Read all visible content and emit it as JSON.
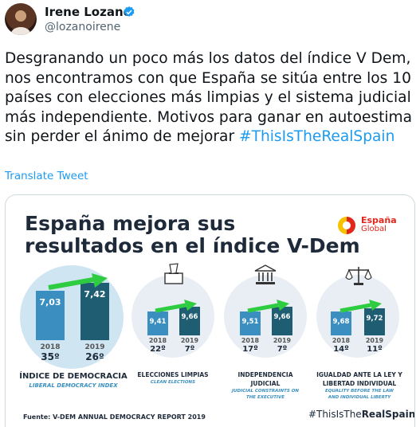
{
  "author": {
    "display_name": "Irene Lozano",
    "handle": "@lozanoirene",
    "verified_icon": "verified-badge-icon"
  },
  "tweet": {
    "text": "Desgranando un poco más los datos del índice V Dem, nos encontramos con que España se sitúa entre los 10 países con elecciones más limpias y el sistema judicial más independiente. Motivos para ganar en autoestima sin perder el ánimo de mejorar ",
    "hashtag": "#ThisIsTheRealSpain",
    "translate_label": "Translate Tweet"
  },
  "colors": {
    "link": "#1d9bf0",
    "bar_2018": "#3a8fc0",
    "bar_2019": "#1f5d73",
    "arrow": "#2ecc40",
    "brand_red": "#e1261c"
  },
  "infographic": {
    "title_line1": "España mejora sus",
    "title_line2": "resultados en el índice V-Dem",
    "brand_name": "España",
    "brand_sub": "Global",
    "source": "Fuente: V-DEM ANNUAL DEMOCRACY REPORT 2019",
    "hashtag_prefix": "#ThisIsThe",
    "hashtag_bold": "RealSpain",
    "panels": [
      {
        "caption": "ÍNDICE DE DEMOCRACIA",
        "subcaption": "LIBERAL DEMOCRACY INDEX",
        "icon": "none",
        "value_2018": "7,03",
        "value_2019": "7,42",
        "year_2018": "2018",
        "year_2019": "2019",
        "rank_2018": "35º",
        "rank_2019": "26º"
      },
      {
        "caption": "ELECCIONES LIMPIAS",
        "subcaption": "CLEAN ELECTIONS",
        "icon": "ballot-box-icon",
        "value_2018": "9,41",
        "value_2019": "9,66",
        "year_2018": "2018",
        "year_2019": "2019",
        "rank_2018": "22º",
        "rank_2019": "7º"
      },
      {
        "caption": "INDEPENDENCIA JUDICIAL",
        "subcaption": "JUDICIAL CONSTRAINTS ON THE EXECUTIVE",
        "icon": "courthouse-icon",
        "value_2018": "9,51",
        "value_2019": "9,66",
        "year_2018": "2018",
        "year_2019": "2019",
        "rank_2018": "17º",
        "rank_2019": "7º"
      },
      {
        "caption": "IGUALDAD ANTE LA LEY Y LIBERTAD INDIVIDUAL",
        "subcaption": "EQUALITY BEFORE THE LAW AND INDIVIDUAL LIBERTY",
        "icon": "scales-icon",
        "value_2018": "9,68",
        "value_2019": "9,72",
        "year_2018": "2018",
        "year_2019": "2019",
        "rank_2018": "14º",
        "rank_2019": "11º"
      }
    ]
  }
}
